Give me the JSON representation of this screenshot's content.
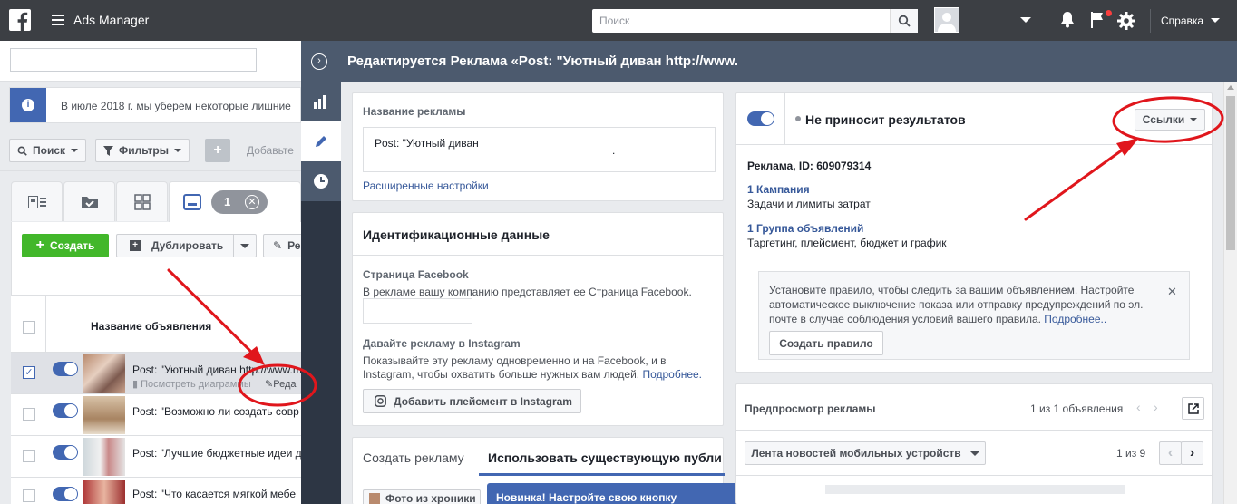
{
  "topbar": {
    "app_title": "Ads Manager",
    "search_placeholder": "Поиск",
    "help_label": "Справка"
  },
  "left": {
    "info_text": "В июле 2018 г. мы уберем некоторые лишние",
    "search_btn": "Поиск",
    "filters_btn": "Фильтры",
    "add_placeholder": "Добавьте",
    "selected_count": "1",
    "create_btn": "Создать",
    "duplicate_btn": "Дублировать",
    "edit_btn": "Ре",
    "col_ad_name": "Название объявления",
    "rows": [
      {
        "name": "Post: \"Уютный диван http://www.m",
        "sub": "Посмотреть диаграммы",
        "edit": "Реда"
      },
      {
        "name": "Post: \"Возможно ли создать совр"
      },
      {
        "name": "Post: \"Лучшие бюджетные идеи д"
      },
      {
        "name": "Post: \"Что касается мягкой мебе"
      }
    ]
  },
  "panel": {
    "title": "Редактируется Реклама «Post: \"Уютный диван http://www.",
    "ad_name_label": "Название рекламы",
    "ad_name_value": "Post: \"Уютный диван",
    "ad_name_tail": ".",
    "advanced_link": "Расширенные настройки",
    "identity_title": "Идентификационные данные",
    "fb_page_label": "Страница Facebook",
    "fb_page_desc": "В рекламе вашу компанию представляет ее Страница Facebook.",
    "ig_label": "Давайте рекламу в Instagram",
    "ig_desc": "Показывайте эту рекламу одновременно и на Facebook, и в Instagram, чтобы охватить больше нужных вам людей.",
    "ig_more": "Подробнее.",
    "ig_btn": "Добавить плейсмент в Instagram",
    "tab_create": "Создать рекламу",
    "tab_existing": "Использовать существующую публи",
    "photo_btn": "Фото из хроники",
    "notice": "Новинка! Настройте свою кнопку",
    "status_text": "Не приносит результатов",
    "links_btn": "Ссылки",
    "ad_id": "Реклама, ID: 609079314",
    "campaign_link": "1 Кампания",
    "campaign_sub": "Задачи и лимиты затрат",
    "adset_link": "1 Группа объявлений",
    "adset_sub": "Таргетинг, плейсмент, бюджет и график",
    "rule_text": "Установите правило, чтобы следить за вашим объявлением. Настройте автоматическое выключение показа или отправку предупреждений по эл. почте в случае соблюдения условий вашего правила.",
    "rule_more": "Подробнее..",
    "rule_btn": "Создать правило",
    "preview_title": "Предпросмотр рекламы",
    "preview_count": "1 из 1 объявления",
    "placement_select": "Лента новостей мобильных устройств",
    "placement_count": "1 из 9"
  },
  "colors": {
    "fb_blue": "#4267b2",
    "topbar": "#4a4a4a",
    "panel_header": "#4c5a6e",
    "green": "#42b72a",
    "annotation": "#e0161c"
  }
}
